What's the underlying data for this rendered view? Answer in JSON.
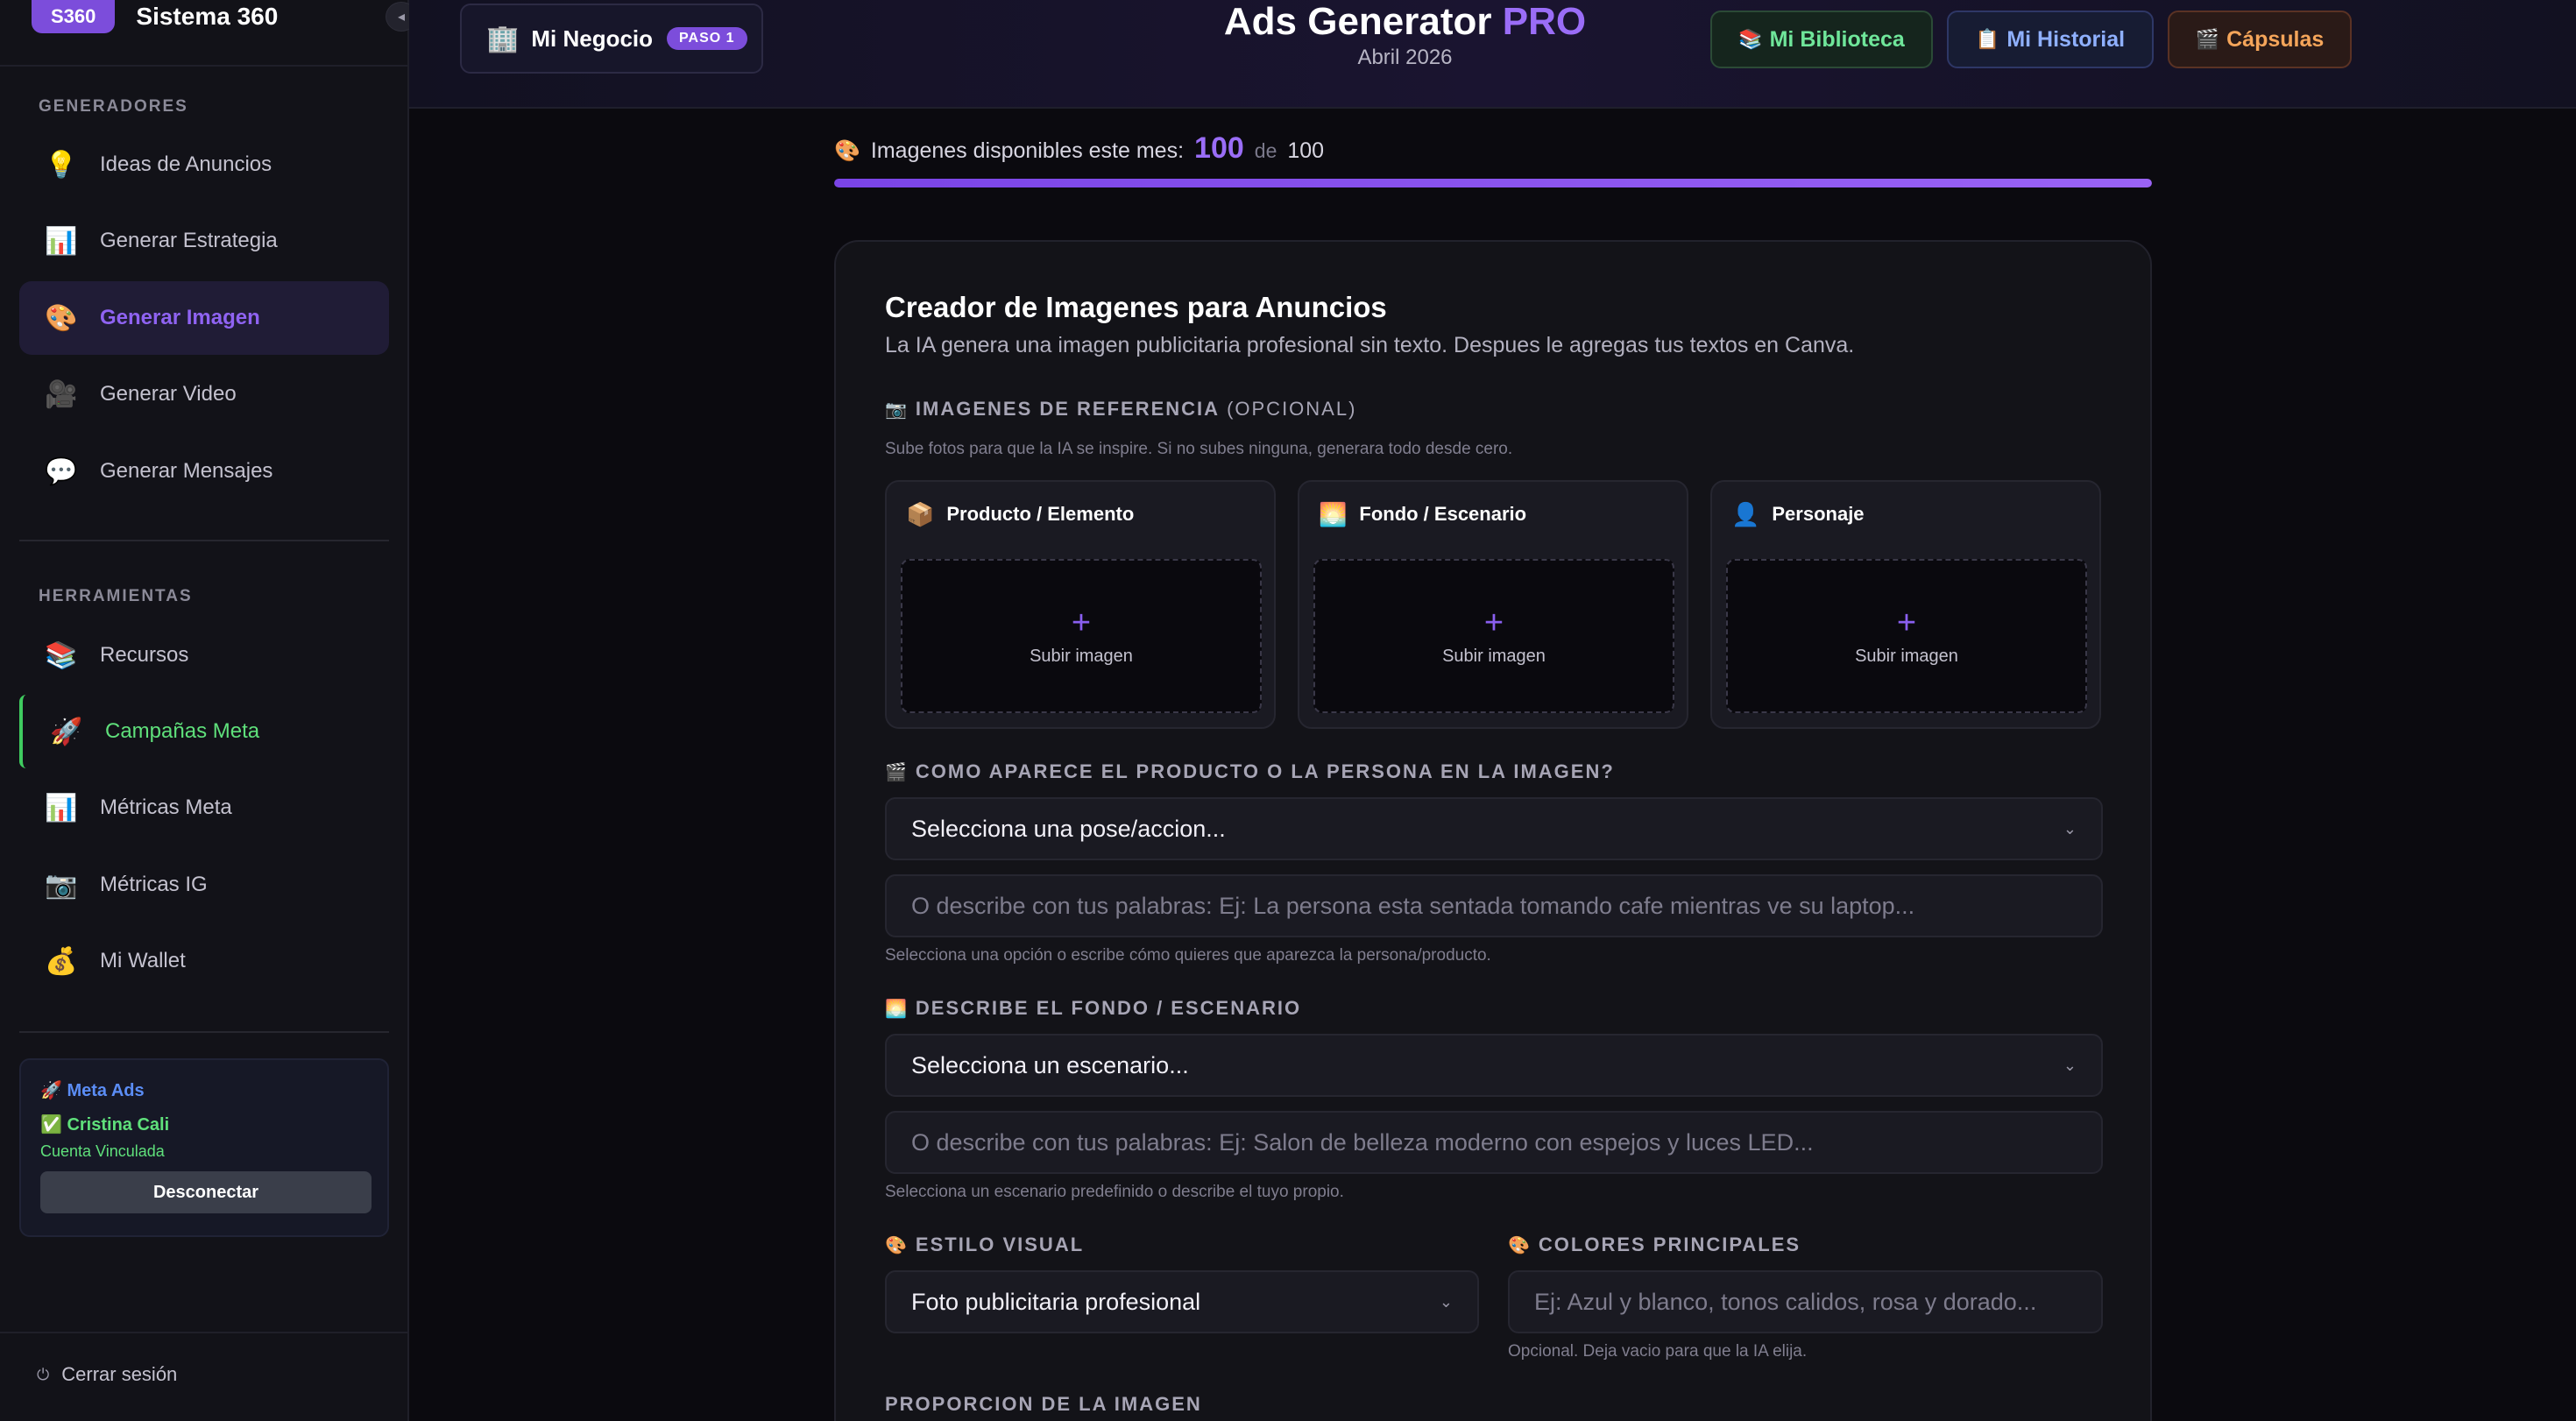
{
  "brand": {
    "badge": "S360",
    "name": "Sistema 360",
    "collapse_icon": "◂"
  },
  "sidebar": {
    "section_generators": "GENERADORES",
    "section_tools": "HERRAMIENTAS",
    "items": [
      {
        "label": "Ideas de Anuncios",
        "icon": "💡"
      },
      {
        "label": "Generar Estrategia",
        "icon": "📊"
      },
      {
        "label": "Generar Imagen",
        "icon": "🎨"
      },
      {
        "label": "Generar Video",
        "icon": "🎥"
      },
      {
        "label": "Generar Mensajes",
        "icon": "💬"
      },
      {
        "label": "Recursos",
        "icon": "📚"
      },
      {
        "label": "Campañas Meta",
        "icon": "🚀"
      },
      {
        "label": "Métricas Meta",
        "icon": "📊"
      },
      {
        "label": "Métricas IG",
        "icon": "📷"
      },
      {
        "label": "Mi Wallet",
        "icon": "💰"
      }
    ],
    "meta": {
      "title": "🚀 Meta Ads",
      "user": "✅ Cristina Cali",
      "status": "Cuenta Vinculada",
      "button": "Desconectar"
    },
    "logout": {
      "label": "Cerrar sesión",
      "icon": "⏻"
    }
  },
  "header": {
    "business": {
      "icon": "🏢",
      "label": "Mi Negocio",
      "badge": "PASO 1"
    },
    "title": "Ads Generator",
    "title_accent": "PRO",
    "date": "Abril 2026",
    "buttons": [
      {
        "icon": "📚",
        "label": "Mi Biblioteca"
      },
      {
        "icon": "📋",
        "label": "Mi Historial"
      },
      {
        "icon": "🎬",
        "label": "Cápsulas"
      }
    ]
  },
  "quota": {
    "icon": "🎨",
    "label": "Imagenes disponibles este mes:",
    "available": "100",
    "of": "de",
    "total": "100",
    "fraction": 1.0
  },
  "form": {
    "title": "Creador de Imagenes para Anuncios",
    "subtitle": "La IA genera una imagen publicitaria profesional sin texto. Despues le agregas tus textos en Canva.",
    "ref_label": "IMAGENES DE REFERENCIA",
    "ref_label_icon": "📷",
    "ref_optional": "(OPCIONAL)",
    "ref_hint": "Sube fotos para que la IA se inspire. Si no subes ninguna, generara todo desde cero.",
    "refs": [
      {
        "icon": "📦",
        "label": "Producto / Elemento",
        "plus": "+",
        "upload": "Subir imagen"
      },
      {
        "icon": "🌅",
        "label": "Fondo / Escenario",
        "plus": "+",
        "upload": "Subir imagen"
      },
      {
        "icon": "👤",
        "label": "Personaje",
        "plus": "+",
        "upload": "Subir imagen"
      }
    ],
    "pose_label": "COMO APARECE EL PRODUCTO O LA PERSONA EN LA IMAGEN?",
    "pose_icon": "🎬",
    "pose_select": "Selecciona una pose/accion...",
    "pose_placeholder": "O describe con tus palabras: Ej: La persona esta sentada tomando cafe mientras ve su laptop...",
    "pose_hint": "Selecciona una opción o escribe cómo quieres que aparezca la persona/producto.",
    "bg_label": "DESCRIBE EL FONDO / ESCENARIO",
    "bg_icon": "🌅",
    "bg_select": "Selecciona un escenario...",
    "bg_placeholder": "O describe con tus palabras: Ej: Salon de belleza moderno con espejos y luces LED...",
    "bg_hint": "Selecciona un escenario predefinido o describe el tuyo propio.",
    "style_label": "ESTILO VISUAL",
    "style_icon": "🎨",
    "style_select": "Foto publicitaria profesional",
    "colors_label": "COLORES PRINCIPALES",
    "colors_icon": "🎨",
    "colors_placeholder": "Ej: Azul y blanco, tonos calidos, rosa y dorado...",
    "colors_hint": "Opcional. Deja vacio para que la IA elija.",
    "ratio_label": "PROPORCION DE LA IMAGEN",
    "chevron": "⌄"
  }
}
